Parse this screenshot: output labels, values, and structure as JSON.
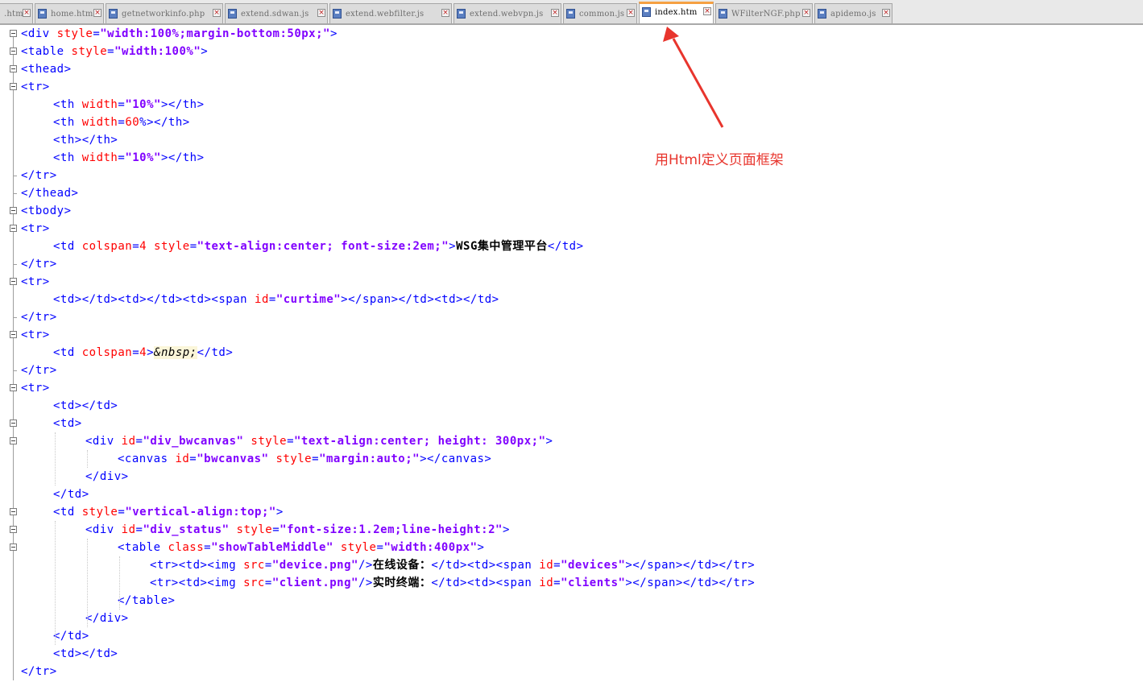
{
  "tabs": [
    {
      "label": ".htm",
      "active": false
    },
    {
      "label": "home.htm",
      "active": false
    },
    {
      "label": "getnetworkinfo.php",
      "active": false
    },
    {
      "label": "extend.sdwan.js",
      "active": false
    },
    {
      "label": "extend.webfilter.js",
      "active": false
    },
    {
      "label": "extend.webvpn.js",
      "active": false
    },
    {
      "label": "common.js",
      "active": false
    },
    {
      "label": "index.htm",
      "active": true
    },
    {
      "label": "WFilterNGF.php",
      "active": false
    },
    {
      "label": "apidemo.js",
      "active": false
    }
  ],
  "code_lines": [
    {
      "indent": 0,
      "segs": [
        [
          "tag",
          "<div "
        ],
        [
          "attr",
          "style"
        ],
        [
          "tag",
          "="
        ],
        [
          "str",
          "\"width:100%;margin-bottom:50px;\""
        ],
        [
          "tag",
          ">"
        ]
      ]
    },
    {
      "indent": 0,
      "segs": [
        [
          "tag",
          "<table "
        ],
        [
          "attr",
          "style"
        ],
        [
          "tag",
          "="
        ],
        [
          "str",
          "\"width:100%\""
        ],
        [
          "tag",
          ">"
        ]
      ]
    },
    {
      "indent": 0,
      "segs": [
        [
          "tag",
          "<thead>"
        ]
      ]
    },
    {
      "indent": 0,
      "segs": [
        [
          "tag",
          "<tr>"
        ]
      ]
    },
    {
      "indent": 1,
      "segs": [
        [
          "tag",
          "<th "
        ],
        [
          "attr",
          "width"
        ],
        [
          "tag",
          "="
        ],
        [
          "str",
          "\"10%\""
        ],
        [
          "tag",
          "></th>"
        ]
      ]
    },
    {
      "indent": 1,
      "segs": [
        [
          "tag",
          "<th "
        ],
        [
          "attr",
          "width"
        ],
        [
          "tag",
          "="
        ],
        [
          "attr",
          "60"
        ],
        [
          "tag",
          "%></th>"
        ]
      ]
    },
    {
      "indent": 1,
      "segs": [
        [
          "tag",
          "<th></th>"
        ]
      ]
    },
    {
      "indent": 1,
      "segs": [
        [
          "tag",
          "<th "
        ],
        [
          "attr",
          "width"
        ],
        [
          "tag",
          "="
        ],
        [
          "str",
          "\"10%\""
        ],
        [
          "tag",
          "></th>"
        ]
      ]
    },
    {
      "indent": 0,
      "segs": [
        [
          "tag",
          "</tr>"
        ]
      ]
    },
    {
      "indent": 0,
      "segs": [
        [
          "tag",
          "</thead>"
        ]
      ]
    },
    {
      "indent": 0,
      "segs": [
        [
          "tag",
          "<tbody>"
        ]
      ]
    },
    {
      "indent": 0,
      "segs": [
        [
          "tag",
          "<tr>"
        ]
      ]
    },
    {
      "indent": 1,
      "segs": [
        [
          "tag",
          "<td "
        ],
        [
          "attr",
          "colspan"
        ],
        [
          "tag",
          "="
        ],
        [
          "attr",
          "4"
        ],
        [
          "tag",
          " "
        ],
        [
          "attr",
          "style"
        ],
        [
          "tag",
          "="
        ],
        [
          "str",
          "\"text-align:center; font-size:2em;\""
        ],
        [
          "tag",
          ">"
        ],
        [
          "text",
          "WSG集中管理平台"
        ],
        [
          "tag",
          "</td>"
        ]
      ]
    },
    {
      "indent": 0,
      "segs": [
        [
          "tag",
          "</tr>"
        ]
      ]
    },
    {
      "indent": 0,
      "segs": [
        [
          "tag",
          "<tr>"
        ]
      ]
    },
    {
      "indent": 1,
      "segs": [
        [
          "tag",
          "<td></td><td></td><td><span "
        ],
        [
          "attr",
          "id"
        ],
        [
          "tag",
          "="
        ],
        [
          "str",
          "\"curtime\""
        ],
        [
          "tag",
          "></span></td><td></td>"
        ]
      ]
    },
    {
      "indent": 0,
      "segs": [
        [
          "tag",
          "</tr>"
        ]
      ]
    },
    {
      "indent": 0,
      "segs": [
        [
          "tag",
          "<tr>"
        ]
      ]
    },
    {
      "indent": 1,
      "segs": [
        [
          "tag",
          "<td "
        ],
        [
          "attr",
          "colspan"
        ],
        [
          "tag",
          "="
        ],
        [
          "attr",
          "4"
        ],
        [
          "tag",
          ">"
        ],
        [
          "ent",
          "&nbsp;"
        ],
        [
          "tag",
          "</td>"
        ]
      ]
    },
    {
      "indent": 0,
      "segs": [
        [
          "tag",
          "</tr>"
        ]
      ]
    },
    {
      "indent": 0,
      "segs": [
        [
          "tag",
          "<tr>"
        ]
      ]
    },
    {
      "indent": 1,
      "segs": [
        [
          "tag",
          "<td></td>"
        ]
      ]
    },
    {
      "indent": 1,
      "segs": [
        [
          "tag",
          "<td>"
        ]
      ]
    },
    {
      "indent": 2,
      "segs": [
        [
          "tag",
          "<div "
        ],
        [
          "attr",
          "id"
        ],
        [
          "tag",
          "="
        ],
        [
          "str",
          "\"div_bwcanvas\""
        ],
        [
          "tag",
          " "
        ],
        [
          "attr",
          "style"
        ],
        [
          "tag",
          "="
        ],
        [
          "str",
          "\"text-align:center; height: 300px;\""
        ],
        [
          "tag",
          ">"
        ]
      ]
    },
    {
      "indent": 3,
      "segs": [
        [
          "tag",
          "<canvas "
        ],
        [
          "attr",
          "id"
        ],
        [
          "tag",
          "="
        ],
        [
          "str",
          "\"bwcanvas\""
        ],
        [
          "tag",
          " "
        ],
        [
          "attr",
          "style"
        ],
        [
          "tag",
          "="
        ],
        [
          "str",
          "\"margin:auto;\""
        ],
        [
          "tag",
          "></canvas>"
        ]
      ]
    },
    {
      "indent": 2,
      "segs": [
        [
          "tag",
          "</div>"
        ]
      ]
    },
    {
      "indent": 1,
      "segs": [
        [
          "tag",
          "</td>"
        ]
      ]
    },
    {
      "indent": 1,
      "segs": [
        [
          "tag",
          "<td "
        ],
        [
          "attr",
          "style"
        ],
        [
          "tag",
          "="
        ],
        [
          "str",
          "\"vertical-align:top;\""
        ],
        [
          "tag",
          ">"
        ]
      ]
    },
    {
      "indent": 2,
      "segs": [
        [
          "tag",
          "<div "
        ],
        [
          "attr",
          "id"
        ],
        [
          "tag",
          "="
        ],
        [
          "str",
          "\"div_status\""
        ],
        [
          "tag",
          " "
        ],
        [
          "attr",
          "style"
        ],
        [
          "tag",
          "="
        ],
        [
          "str",
          "\"font-size:1.2em;line-height:2\""
        ],
        [
          "tag",
          ">"
        ]
      ]
    },
    {
      "indent": 3,
      "segs": [
        [
          "tag",
          "<table "
        ],
        [
          "attr",
          "class"
        ],
        [
          "tag",
          "="
        ],
        [
          "str",
          "\"showTableMiddle\""
        ],
        [
          "tag",
          " "
        ],
        [
          "attr",
          "style"
        ],
        [
          "tag",
          "="
        ],
        [
          "str",
          "\"width:400px\""
        ],
        [
          "tag",
          ">"
        ]
      ]
    },
    {
      "indent": 4,
      "segs": [
        [
          "tag",
          "<tr><td><img "
        ],
        [
          "attr",
          "src"
        ],
        [
          "tag",
          "="
        ],
        [
          "str",
          "\"device.png\""
        ],
        [
          "tag",
          "/>"
        ],
        [
          "text",
          "在线设备："
        ],
        [
          "tag",
          "</td><td><span "
        ],
        [
          "attr",
          "id"
        ],
        [
          "tag",
          "="
        ],
        [
          "str",
          "\"devices\""
        ],
        [
          "tag",
          "></span></td></tr>"
        ]
      ]
    },
    {
      "indent": 4,
      "segs": [
        [
          "tag",
          "<tr><td><img "
        ],
        [
          "attr",
          "src"
        ],
        [
          "tag",
          "="
        ],
        [
          "str",
          "\"client.png\""
        ],
        [
          "tag",
          "/>"
        ],
        [
          "text",
          "实时终端："
        ],
        [
          "tag",
          "</td><td><span "
        ],
        [
          "attr",
          "id"
        ],
        [
          "tag",
          "="
        ],
        [
          "str",
          "\"clients\""
        ],
        [
          "tag",
          "></span></td></tr>"
        ]
      ]
    },
    {
      "indent": 3,
      "segs": [
        [
          "tag",
          "</table>"
        ]
      ]
    },
    {
      "indent": 2,
      "segs": [
        [
          "tag",
          "</div>"
        ]
      ]
    },
    {
      "indent": 1,
      "segs": [
        [
          "tag",
          "</td>"
        ]
      ]
    },
    {
      "indent": 1,
      "segs": [
        [
          "tag",
          "<td></td>"
        ]
      ]
    },
    {
      "indent": 0,
      "segs": [
        [
          "tag",
          "</tr>"
        ]
      ]
    }
  ],
  "annotation": {
    "label": "用Html定义页面框架",
    "color": "#e8352d"
  },
  "colors": {
    "tag": "#0000ff",
    "attr": "#ff0000",
    "string": "#8000ff",
    "text": "#000000",
    "active_tab_accent": "#f5a042"
  },
  "icons": {
    "file": "file-icon",
    "close": "close-icon",
    "fold": "fold-minus-icon"
  }
}
